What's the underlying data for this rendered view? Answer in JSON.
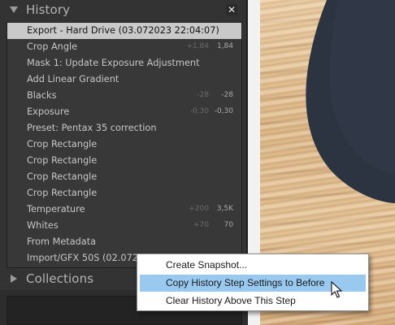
{
  "history_panel": {
    "title": "History",
    "close_glyph": "✕",
    "items": [
      {
        "label": "Export - Hard Drive (03.072023 22:04:07)",
        "before": "",
        "after": "",
        "selected": true
      },
      {
        "label": "Crop Angle",
        "before": "+1,84",
        "after": "1,84"
      },
      {
        "label": "Mask 1: Update Exposure Adjustment",
        "before": "",
        "after": ""
      },
      {
        "label": "Add Linear Gradient",
        "before": "",
        "after": ""
      },
      {
        "label": "Blacks",
        "before": "-28",
        "after": "-28"
      },
      {
        "label": "Exposure",
        "before": "-0,30",
        "after": "-0,30"
      },
      {
        "label": "Preset: Pentax 35 correction",
        "before": "",
        "after": ""
      },
      {
        "label": "Crop Rectangle",
        "before": "",
        "after": ""
      },
      {
        "label": "Crop Rectangle",
        "before": "",
        "after": ""
      },
      {
        "label": "Crop Rectangle",
        "before": "",
        "after": ""
      },
      {
        "label": "Crop Rectangle",
        "before": "",
        "after": ""
      },
      {
        "label": "Temperature",
        "before": "+200",
        "after": "3,5K"
      },
      {
        "label": "Whites",
        "before": "+70",
        "after": "70"
      },
      {
        "label": "From Metadata",
        "before": "",
        "after": ""
      },
      {
        "label": "Import/GFX 50S (02.072023",
        "before": "",
        "after": ""
      }
    ]
  },
  "collections_panel": {
    "title": "Collections"
  },
  "context_menu": {
    "items": [
      {
        "label": "Create Snapshot...",
        "highlighted": false
      },
      {
        "label": "Copy History Step Settings to Before",
        "highlighted": true
      },
      {
        "label": "Clear History Above This Step",
        "highlighted": false
      }
    ]
  },
  "icons": {
    "history_toggle": "triangle-down-icon",
    "collections_toggle": "triangle-right-icon",
    "close": "close-icon",
    "cursor": "mouse-pointer-icon"
  },
  "colors": {
    "panel_bg": "#333333",
    "selected_row": "#c9c9c9",
    "menu_highlight": "#99c9ef"
  }
}
